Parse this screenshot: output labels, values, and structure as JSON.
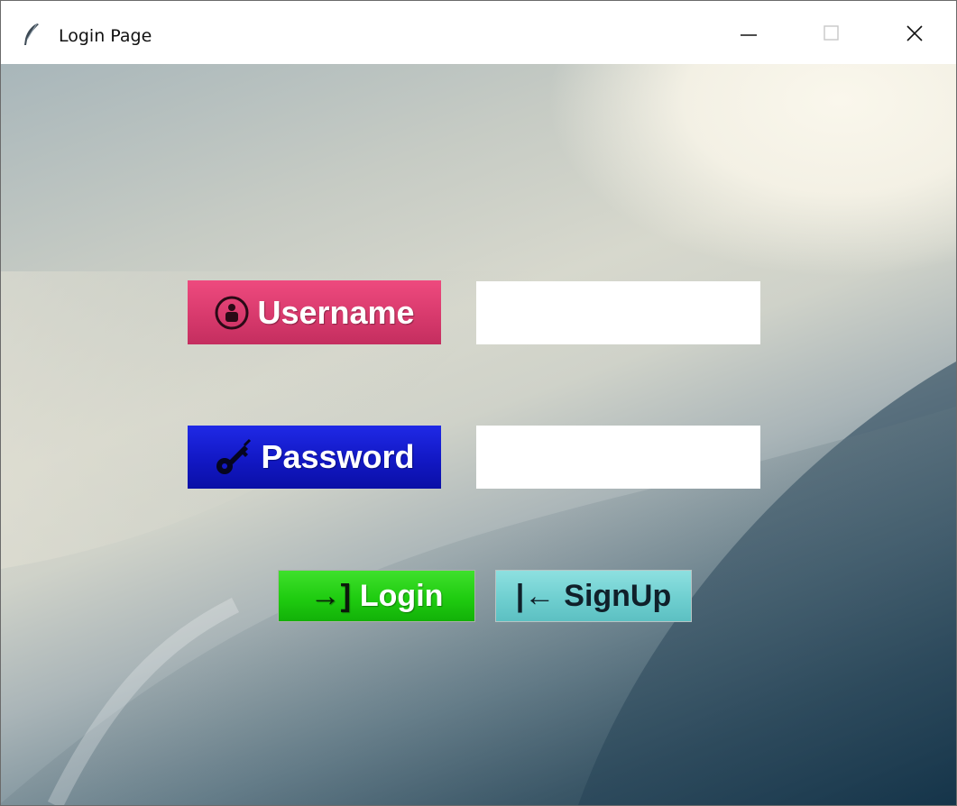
{
  "window": {
    "title": "Login Page",
    "icon": "feather-icon",
    "controls": [
      "minimize-icon",
      "maximize-icon",
      "close-icon"
    ]
  },
  "form": {
    "username_label": "Username",
    "username_icon": "user-circle-icon",
    "username_value": "",
    "password_label": "Password",
    "password_icon": "key-icon",
    "password_value": ""
  },
  "buttons": {
    "login_label": "Login",
    "login_glyph": "→]",
    "login_icon": "enter-arrow-icon",
    "signup_label": "SignUp",
    "signup_glyph": "|←",
    "signup_icon": "back-arrow-icon"
  },
  "colors": {
    "username_bg": "#e04477",
    "password_bg": "#1a1fd6",
    "login_bg": "#22cc14",
    "signup_bg": "#72d2d2"
  }
}
